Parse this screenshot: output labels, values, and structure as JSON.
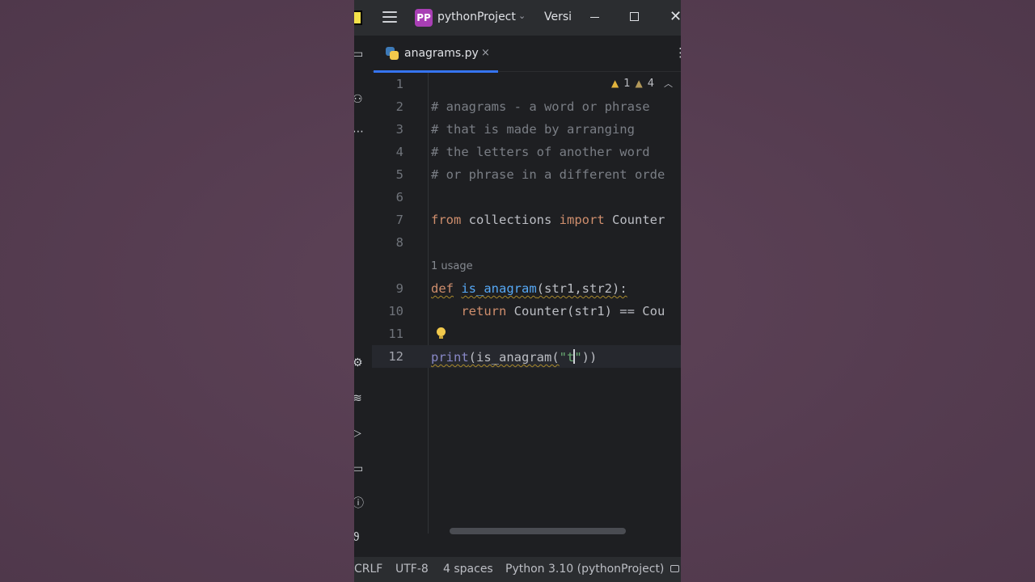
{
  "titlebar": {
    "project_badge": "PP",
    "project_name": "pythonProject",
    "vcs_label": "Versi"
  },
  "tab": {
    "file_name": "anagrams.py",
    "close_glyph": "×"
  },
  "inspections": {
    "errors": "1",
    "warnings": "4"
  },
  "editor": {
    "line_numbers": [
      "1",
      "2",
      "3",
      "4",
      "5",
      "6",
      "7",
      "8",
      "9",
      "10",
      "11",
      "12"
    ],
    "line2": "# anagrams - a word or phrase",
    "line3": "# that is made by arranging",
    "line4": "# the letters of another word",
    "line5": "# or phrase in a different orde",
    "line7_kw1": "from",
    "line7_mod": " collections ",
    "line7_kw2": "import",
    "line7_name": " Counter",
    "usage_hint": "1 usage",
    "line9_kw": "def",
    "line9_fn": "is_anagram",
    "line9_rest": "(str1,str2):",
    "line10_kw": "return",
    "line10_rest": " Counter(str1) == Cou",
    "line12_builtin": "print",
    "line12_mid": "(is_anagram(",
    "line12_str": "\"t",
    "line12_strend": "\"",
    "line12_end": "))"
  },
  "statusbar": {
    "line_sep": "CRLF",
    "encoding": "UTF-8",
    "indent": "4 spaces",
    "interpreter": "Python 3.10 (pythonProject)"
  }
}
